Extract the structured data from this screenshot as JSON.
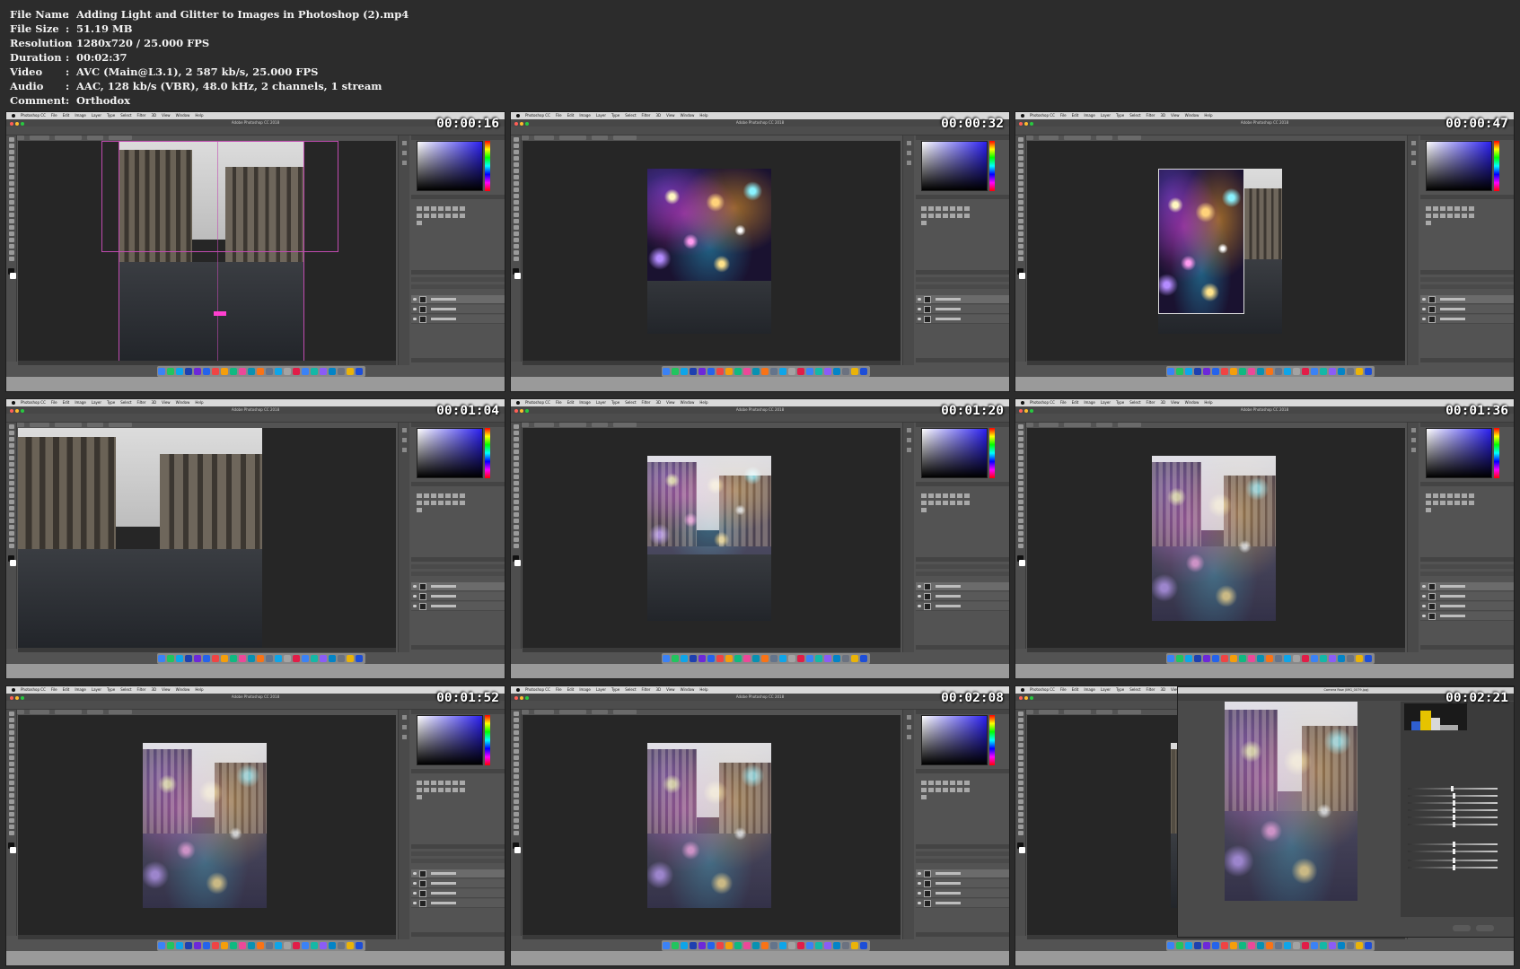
{
  "metadata": {
    "rows": [
      {
        "key": "File Name",
        "value": "Adding Light and Glitter to Images in Photoshop (2).mp4"
      },
      {
        "key": "File Size",
        "value": "51.19 MB"
      },
      {
        "key": "Resolution",
        "value": "1280x720 / 25.000 FPS"
      },
      {
        "key": "Duration",
        "value": "00:02:37"
      },
      {
        "key": "Video",
        "value": "AVC (Main@L3.1), 2 587 kb/s, 25.000 FPS"
      },
      {
        "key": "Audio",
        "value": "AAC, 128 kb/s (VBR), 48.0 kHz, 2 channels, 1 stream"
      },
      {
        "key": "Comment",
        "value": "Orthodox"
      }
    ]
  },
  "app": {
    "menu_items": [
      "Photoshop CC",
      "File",
      "Edit",
      "Image",
      "Layer",
      "Type",
      "Select",
      "Filter",
      "3D",
      "View",
      "Window",
      "Help"
    ],
    "window_title": "Adobe Photoshop CC 2018",
    "camera_raw_title": "Camera Raw (IMG_0079.jpg)"
  },
  "thumbnails": [
    {
      "timecode": "00:00:16",
      "scene": "photo-with-guides"
    },
    {
      "timecode": "00:00:32",
      "scene": "glitter-over-photo-top"
    },
    {
      "timecode": "00:00:47",
      "scene": "glitter-transform"
    },
    {
      "timecode": "00:01:04",
      "scene": "photo-zoomed"
    },
    {
      "timecode": "00:01:20",
      "scene": "glitter-blended"
    },
    {
      "timecode": "00:01:36",
      "scene": "glitter-blended-full"
    },
    {
      "timecode": "00:01:52",
      "scene": "glitter-blended-full"
    },
    {
      "timecode": "00:02:08",
      "scene": "glitter-blended-full"
    },
    {
      "timecode": "00:02:21",
      "scene": "camera-raw"
    }
  ],
  "colors": {
    "background": "#2c2c2c",
    "ps_panel": "#535353",
    "canvas_bg": "#262626",
    "selection_magenta": "#ff3fd0"
  }
}
